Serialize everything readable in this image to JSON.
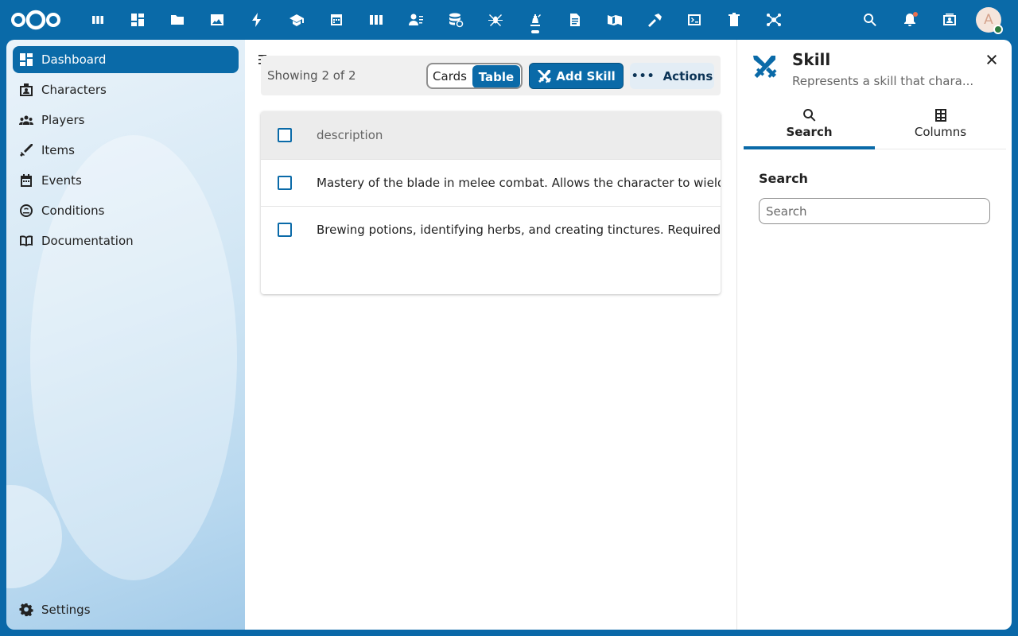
{
  "topbar": {
    "apps": [
      {
        "name": "app-deck-icon"
      },
      {
        "name": "app-dashboard-icon"
      },
      {
        "name": "app-files-icon"
      },
      {
        "name": "app-photos-icon"
      },
      {
        "name": "app-activity-icon"
      },
      {
        "name": "app-learn-icon"
      },
      {
        "name": "app-calendar-icon"
      },
      {
        "name": "app-columns-icon"
      },
      {
        "name": "app-contacts-icon"
      },
      {
        "name": "app-database-icon"
      },
      {
        "name": "app-spider-icon"
      },
      {
        "name": "app-game-icon"
      },
      {
        "name": "app-document-icon"
      },
      {
        "name": "app-map-icon"
      },
      {
        "name": "app-hammer-icon"
      },
      {
        "name": "app-code-icon"
      },
      {
        "name": "app-trash-icon"
      },
      {
        "name": "app-network-icon"
      }
    ],
    "avatar_letter": "A"
  },
  "nav": {
    "items": [
      {
        "label": "Dashboard",
        "icon": "dashboard-icon"
      },
      {
        "label": "Characters",
        "icon": "badge-icon"
      },
      {
        "label": "Players",
        "icon": "group-icon"
      },
      {
        "label": "Items",
        "icon": "sword-icon"
      },
      {
        "label": "Events",
        "icon": "calendar-icon"
      },
      {
        "label": "Conditions",
        "icon": "condition-icon"
      },
      {
        "label": "Documentation",
        "icon": "book-icon"
      }
    ],
    "settings_label": "Settings"
  },
  "toolbar": {
    "showing": "Showing 2 of 2",
    "cards_label": "Cards",
    "table_label": "Table",
    "add_label": "Add Skill",
    "actions_label": "Actions"
  },
  "table": {
    "header": "description",
    "rows": [
      "Mastery of the blade in melee combat. Allows the character to wield swords effectively.",
      "Brewing potions, identifying herbs, and creating tinctures. Required for alchemy."
    ]
  },
  "sidebar": {
    "title": "Skill",
    "subtitle": "Represents a skill that chara...",
    "tabs": [
      {
        "label": "Search"
      },
      {
        "label": "Columns"
      }
    ],
    "search_label": "Search",
    "search_placeholder": "Search"
  },
  "colors": {
    "primary": "#0a6aa8"
  }
}
